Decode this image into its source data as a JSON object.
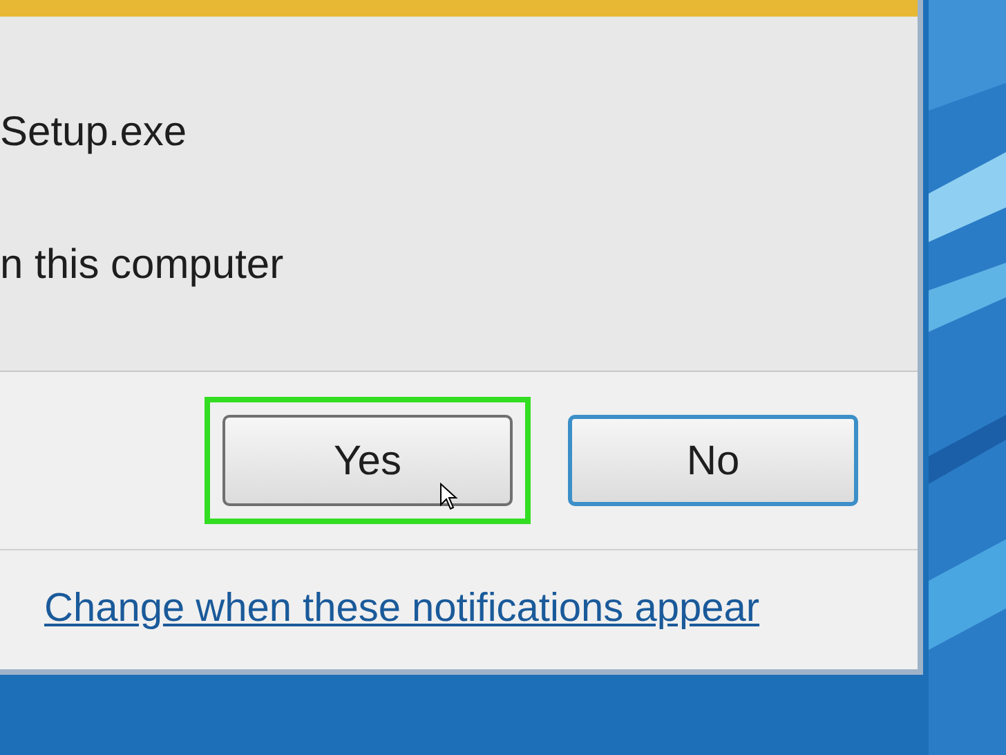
{
  "dialog": {
    "program": "Setup.exe",
    "detail": "n this computer",
    "buttons": [
      {
        "label": "Yes",
        "highlighted": true,
        "default": false
      },
      {
        "label": "No",
        "highlighted": false,
        "default": true
      }
    ],
    "link": "Change when these notifications appear"
  }
}
